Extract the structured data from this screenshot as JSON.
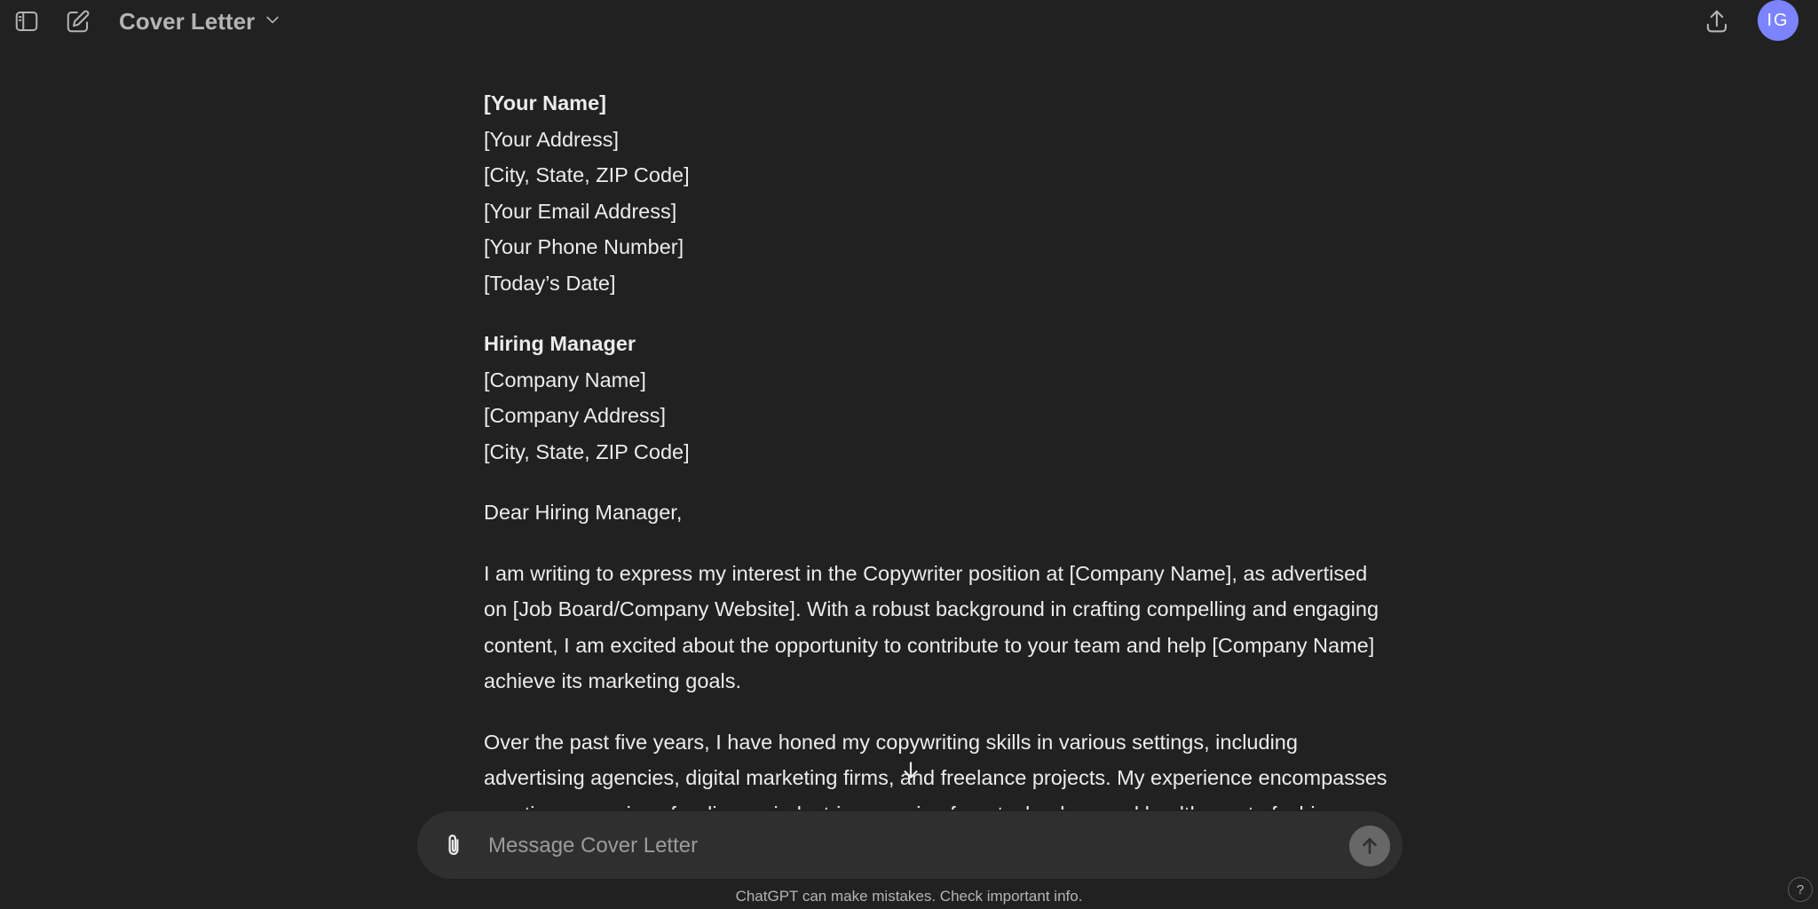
{
  "header": {
    "title": "Cover Letter",
    "avatar_initials": "IG",
    "icons": {
      "sidebar_toggle": "sidebar-toggle-icon",
      "new_chat": "edit-icon",
      "title_chevron": "chevron-down-icon",
      "share": "upload-icon"
    }
  },
  "letter": {
    "sender": {
      "name": "[Your Name]",
      "address": "[Your Address]",
      "city": "[City, State, ZIP Code]",
      "email": "[Your Email Address]",
      "phone": "[Your Phone Number]",
      "date": "[Today’s Date]"
    },
    "recipient": {
      "title": "Hiring Manager",
      "company": "[Company Name]",
      "address": "[Company Address]",
      "city": "[City, State, ZIP Code]"
    },
    "salutation": "Dear Hiring Manager,",
    "paragraph1": [
      "I am writing to express my interest in the Copywriter position at [Company Name], as advertised",
      "on [Job Board/Company Website]. With a robust background in crafting compelling and engaging",
      "content, I am excited about the opportunity to contribute to your team and help [Company Name]",
      "achieve its marketing goals."
    ],
    "paragraph2": [
      "Over the past five years, I have honed my copywriting skills in various settings, including",
      "advertising agencies, digital marketing firms, and freelance projects. My experience encompasses",
      "creating campaigns for diverse industries, ranging from technology and healthcare to fashion"
    ]
  },
  "composer": {
    "placeholder": "Message Cover Letter",
    "icons": {
      "attach": "paperclip-icon",
      "send": "arrow-up-icon",
      "scroll_down": "arrow-down-icon"
    }
  },
  "footer": {
    "disclaimer": "ChatGPT can make mistakes. Check important info.",
    "help_label": "?"
  },
  "colors": {
    "background": "#212121",
    "composer": "#2f2f2f",
    "avatar": "#7b83ff",
    "text": "#ececec",
    "muted": "#b4b4b4"
  }
}
